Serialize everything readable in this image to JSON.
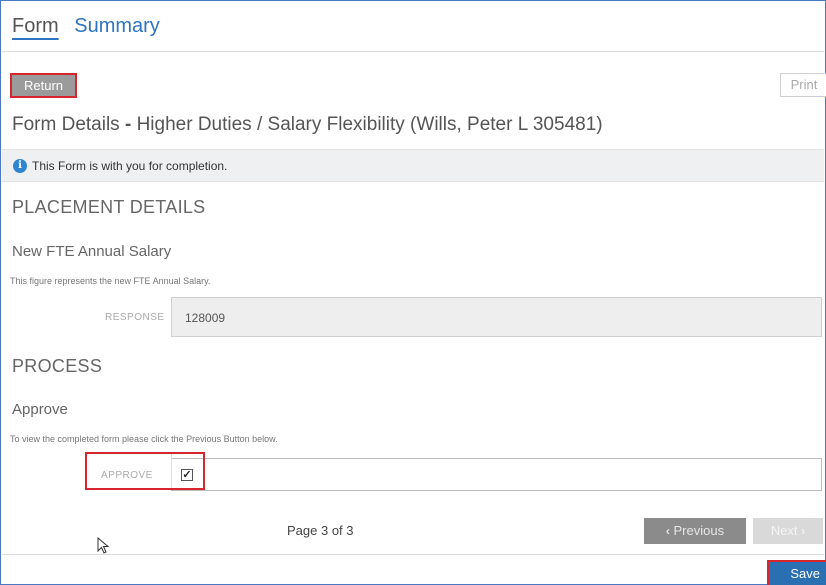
{
  "tabs": {
    "form": "Form",
    "summary": "Summary"
  },
  "toolbar": {
    "return_label": "Return",
    "print_label": "Print"
  },
  "form": {
    "title_prefix": "Form Details",
    "title_sep": "-",
    "title_rest": "Higher Duties / Salary Flexibility (Wills, Peter L 305481)"
  },
  "info": {
    "icon": "info-icon",
    "text": "This Form is with you for completion."
  },
  "placement": {
    "heading": "PLACEMENT DETAILS",
    "question": "New FTE Annual Salary",
    "description": "This figure represents the new FTE Annual Salary.",
    "field_label": "RESPONSE",
    "value": "128009"
  },
  "process": {
    "heading": "PROCESS",
    "question": "Approve",
    "description": "To view the completed form please click the Previous Button below.",
    "field_label": "APPROVE",
    "checked": true,
    "check_glyph": "✓"
  },
  "pager": {
    "page_text": "Page 3 of 3",
    "prev_label": "Previous",
    "next_label": "Next",
    "prev_icon": "‹",
    "next_icon": "›"
  },
  "footer": {
    "save_label": "Save"
  },
  "colors": {
    "accent": "#2f74c0",
    "highlight": "#d6252c",
    "save": "#2b6fb3"
  }
}
